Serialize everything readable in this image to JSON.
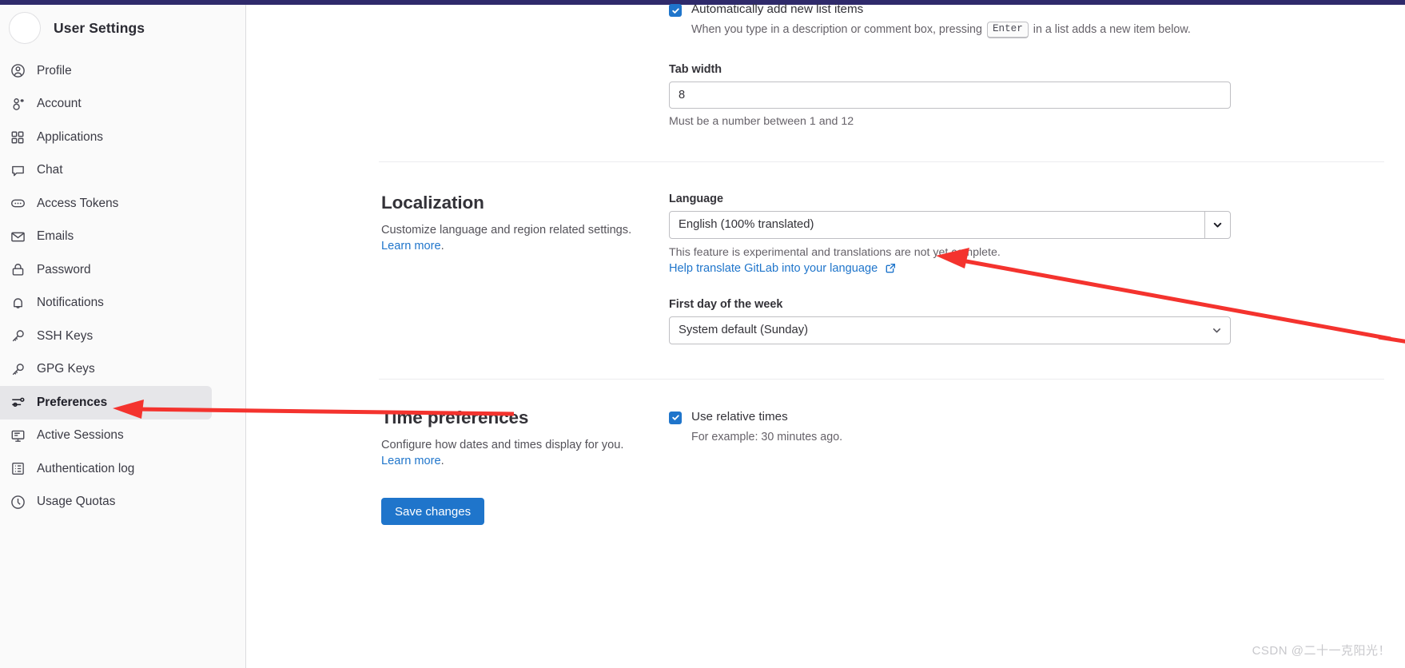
{
  "sidebar": {
    "title": "User Settings",
    "avatar": "user-avatar",
    "items": [
      {
        "label": "Profile",
        "icon": "user-circle-icon",
        "active": false
      },
      {
        "label": "Account",
        "icon": "account-gear-icon",
        "active": false
      },
      {
        "label": "Applications",
        "icon": "applications-grid-icon",
        "active": false
      },
      {
        "label": "Chat",
        "icon": "chat-bubble-icon",
        "active": false
      },
      {
        "label": "Access Tokens",
        "icon": "token-icon",
        "active": false
      },
      {
        "label": "Emails",
        "icon": "envelope-icon",
        "active": false
      },
      {
        "label": "Password",
        "icon": "lock-icon",
        "active": false
      },
      {
        "label": "Notifications",
        "icon": "bell-icon",
        "active": false
      },
      {
        "label": "SSH Keys",
        "icon": "key-icon",
        "active": false
      },
      {
        "label": "GPG Keys",
        "icon": "key-icon",
        "active": false
      },
      {
        "label": "Preferences",
        "icon": "sliders-icon",
        "active": true
      },
      {
        "label": "Active Sessions",
        "icon": "monitor-icon",
        "active": false
      },
      {
        "label": "Authentication log",
        "icon": "log-list-icon",
        "active": false
      },
      {
        "label": "Usage Quotas",
        "icon": "gauge-clock-icon",
        "active": false
      }
    ]
  },
  "behavior": {
    "auto_add_list_items": {
      "label": "Automatically add new list items",
      "checked": true,
      "help_before": "When you type in a description or comment box, pressing",
      "key": "Enter",
      "help_after": "in a list adds a new item below."
    },
    "tab_width": {
      "label": "Tab width",
      "value": "8",
      "help": "Must be a number between 1 and 12"
    }
  },
  "localization": {
    "title": "Localization",
    "description": "Customize language and region related settings.",
    "learn_more": "Learn more",
    "language": {
      "label": "Language",
      "value": "English (100% translated)",
      "help": "This feature is experimental and translations are not yet complete.",
      "translate_link": "Help translate GitLab into your language",
      "external_icon": "external-link-icon"
    },
    "first_day": {
      "label": "First day of the week",
      "value": "System default (Sunday)"
    }
  },
  "time_preferences": {
    "title": "Time preferences",
    "description": "Configure how dates and times display for you.",
    "learn_more": "Learn more",
    "relative_times": {
      "label": "Use relative times",
      "checked": true,
      "help": "For example: 30 minutes ago."
    }
  },
  "actions": {
    "save_label": "Save changes"
  },
  "watermark": "CSDN @二十一克阳光！",
  "colors": {
    "accent": "#1f75cb",
    "annotation": "#f4332e",
    "sidebar_bg": "#fafafa",
    "active_item_bg": "#e6e6e9",
    "topbar": "#2f2a6b"
  }
}
